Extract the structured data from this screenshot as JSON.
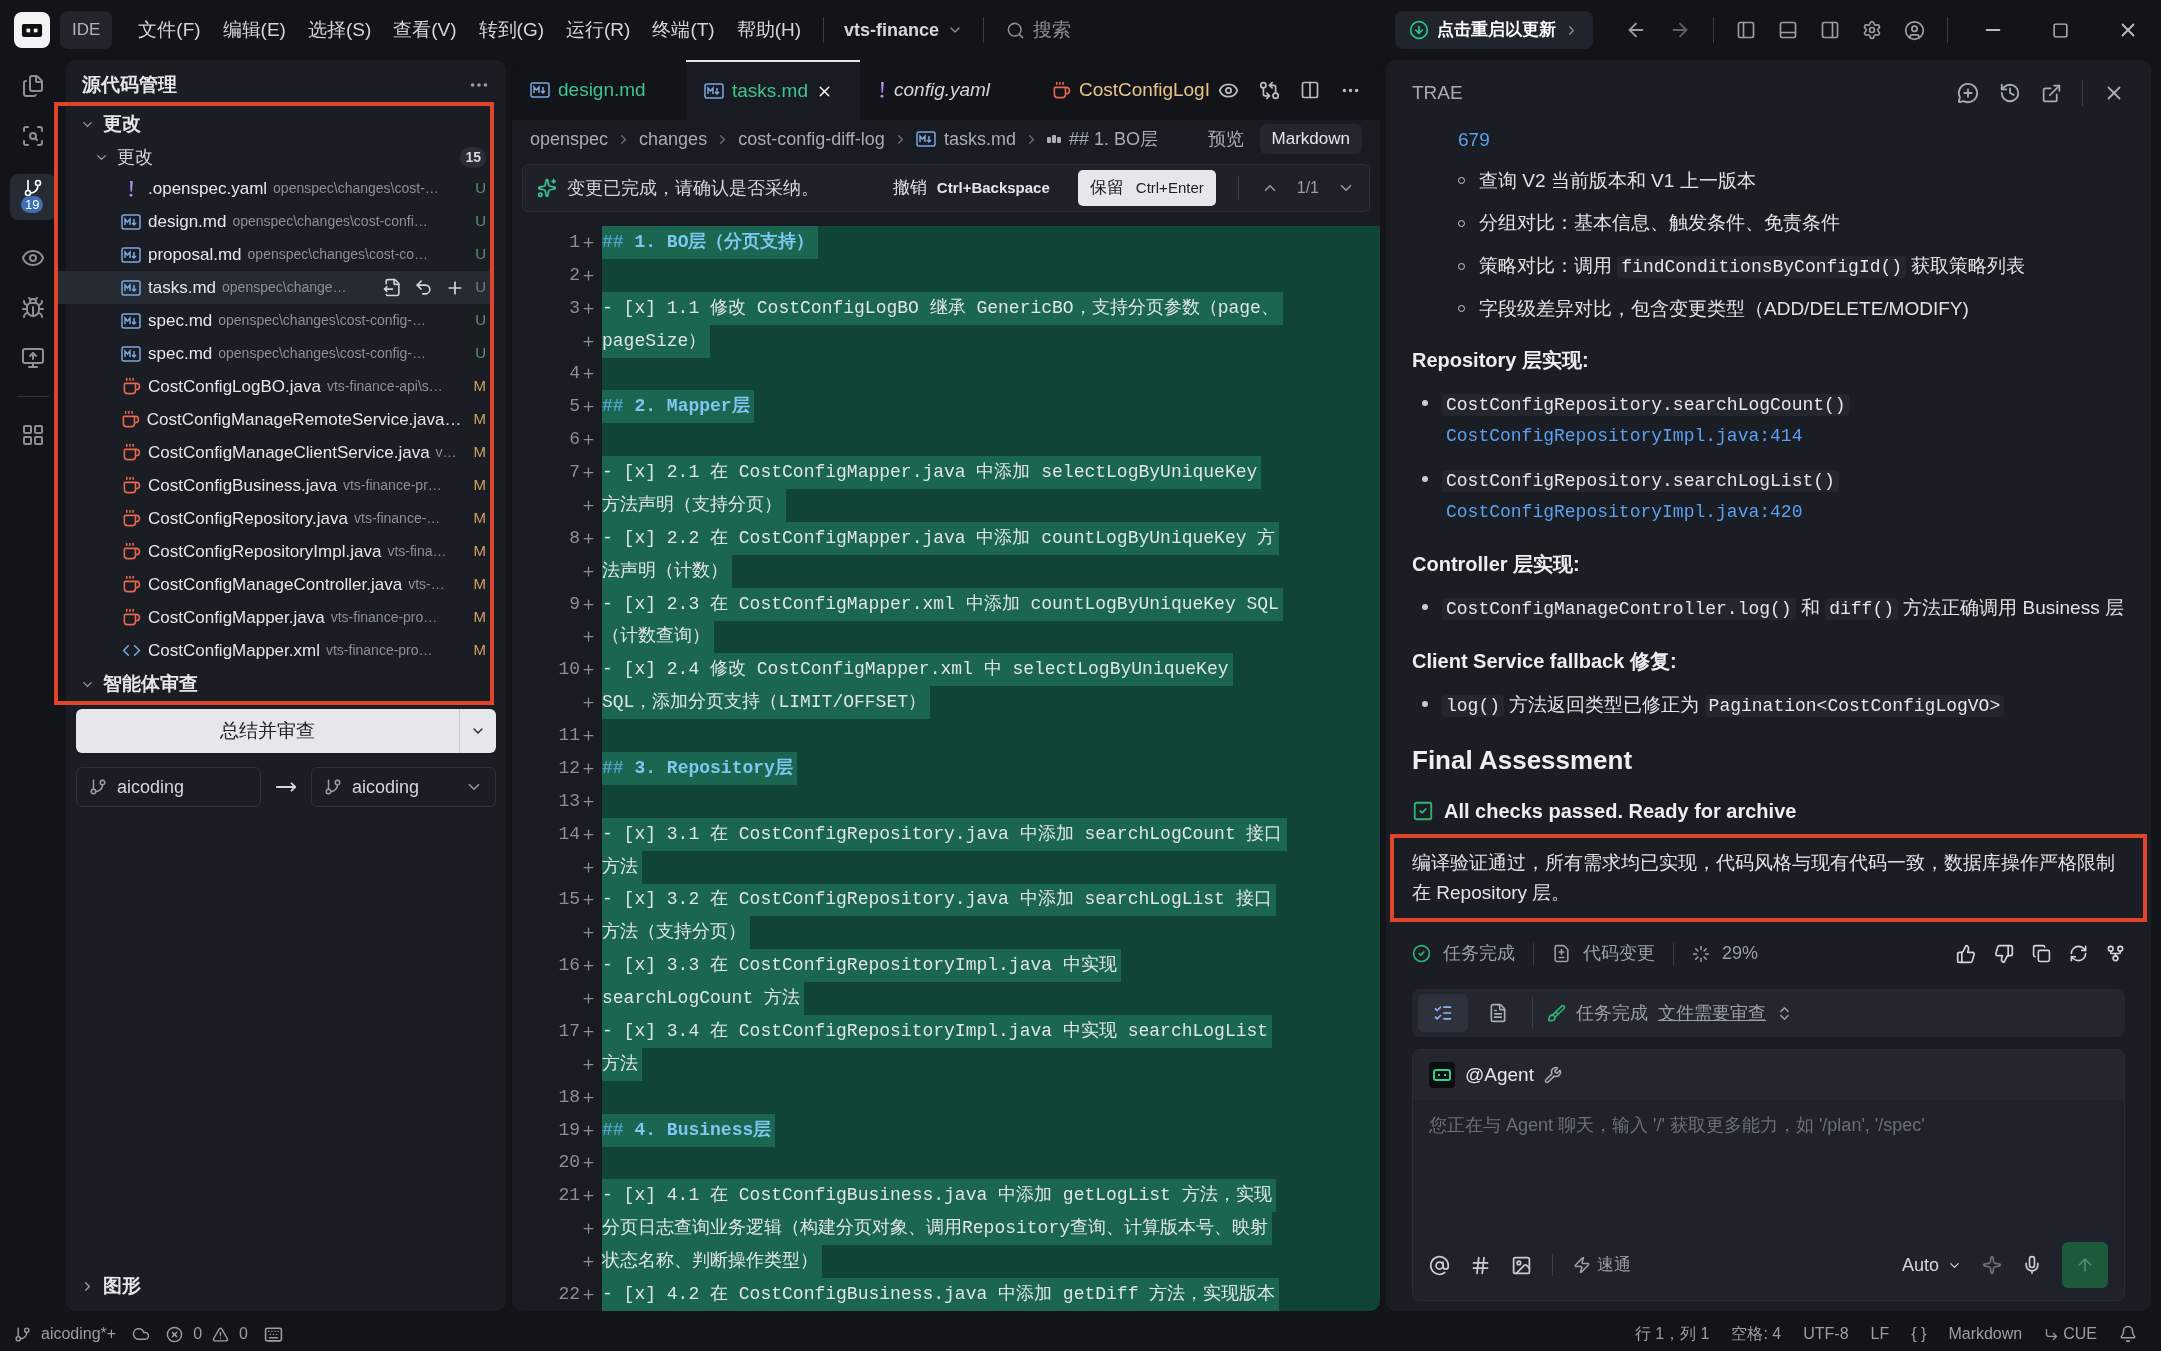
{
  "title_bar": {
    "app_label": "IDE",
    "menu": [
      "文件(F)",
      "编辑(E)",
      "选择(S)",
      "查看(V)",
      "转到(G)",
      "运行(R)",
      "终端(T)",
      "帮助(H)"
    ],
    "project": "vts-finance",
    "search_placeholder": "搜索",
    "update_button": "点击重启以更新"
  },
  "activity_bar": {
    "scm_badge": "19"
  },
  "scm_panel": {
    "title": "源代码管理",
    "section": {
      "label": "更改",
      "expanded": true
    },
    "group": {
      "label": "更改",
      "expanded": true,
      "count": "15"
    },
    "files": [
      {
        "kind": "yaml",
        "name": ".openspec.yaml",
        "path": "openspec\\changes\\cost-…",
        "status": "U",
        "selected": false
      },
      {
        "kind": "md",
        "name": "design.md",
        "path": "openspec\\changes\\cost-confi…",
        "status": "U",
        "selected": false
      },
      {
        "kind": "md",
        "name": "proposal.md",
        "path": "openspec\\changes\\cost-co…",
        "status": "U",
        "selected": false
      },
      {
        "kind": "md",
        "name": "tasks.md",
        "path": "openspec\\change…",
        "status": "U",
        "selected": true
      },
      {
        "kind": "md",
        "name": "spec.md",
        "path": "openspec\\changes\\cost-config-…",
        "status": "U",
        "selected": false
      },
      {
        "kind": "md",
        "name": "spec.md",
        "path": "openspec\\changes\\cost-config-…",
        "status": "U",
        "selected": false
      },
      {
        "kind": "java",
        "name": "CostConfigLogBO.java",
        "path": "vts-finance-api\\s…",
        "status": "M",
        "selected": false
      },
      {
        "kind": "java",
        "name": "CostConfigManageRemoteService.java…",
        "status": "M",
        "selected": false
      },
      {
        "kind": "java",
        "name": "CostConfigManageClientService.java",
        "path": "v…",
        "status": "M",
        "selected": false
      },
      {
        "kind": "java",
        "name": "CostConfigBusiness.java",
        "path": "vts-finance-pr…",
        "status": "M",
        "selected": false
      },
      {
        "kind": "java",
        "name": "CostConfigRepository.java",
        "path": "vts-finance-…",
        "status": "M",
        "selected": false
      },
      {
        "kind": "java",
        "name": "CostConfigRepositoryImpl.java",
        "path": "vts-fina…",
        "status": "M",
        "selected": false
      },
      {
        "kind": "java",
        "name": "CostConfigManageController.java",
        "path": "vts-…",
        "status": "M",
        "selected": false
      },
      {
        "kind": "java",
        "name": "CostConfigMapper.java",
        "path": "vts-finance-pro…",
        "status": "M",
        "selected": false
      },
      {
        "kind": "xml",
        "name": "CostConfigMapper.xml",
        "path": "vts-finance-pro…",
        "status": "M",
        "selected": false
      }
    ],
    "agent_section": {
      "label": "智能体审查",
      "expanded": true
    },
    "review_button": "总结并审查",
    "branch_from": "aicoding",
    "branch_to": "aicoding",
    "graph_section": {
      "label": "图形",
      "expanded": false
    }
  },
  "editor": {
    "tabs": [
      {
        "kind": "md",
        "label": "design.md",
        "selected": false
      },
      {
        "kind": "md",
        "label": "tasks.md",
        "selected": true
      },
      {
        "kind": "yaml",
        "label": "config.yaml",
        "selected": false
      },
      {
        "kind": "java",
        "label": "CostConfigLogI",
        "selected": false
      }
    ],
    "breadcrumb": [
      "openspec",
      "changes",
      "cost-config-diff-log",
      "tasks.md",
      "## 1. BO层"
    ],
    "preview": "预览",
    "language": "Markdown",
    "diff_bar": {
      "message": "变更已完成，请确认是否采纳。",
      "undo": "撤销",
      "undo_shortcut": "Ctrl+Backspace",
      "keep": "保留",
      "keep_shortcut": "Ctrl+Enter",
      "counter": "1/1"
    },
    "lines": [
      {
        "number": "1",
        "kind": "heading",
        "hash": "##",
        "text": "1. BO层（分页支持）",
        "added": true
      },
      {
        "number": "2",
        "kind": "blank",
        "added": true
      },
      {
        "number": "3",
        "kind": "item",
        "text": "- [x] 1.1 修改 CostConfigLogBO 继承 GenericBO，支持分页参数（page、",
        "added": true
      },
      {
        "kind": "wrap",
        "text": "pageSize）",
        "added": true
      },
      {
        "number": "4",
        "kind": "blank",
        "added": true
      },
      {
        "number": "5",
        "kind": "heading",
        "hash": "##",
        "text": "2. Mapper层",
        "added": true
      },
      {
        "number": "6",
        "kind": "blank",
        "added": true
      },
      {
        "number": "7",
        "kind": "item",
        "text": "- [x] 2.1 在 CostConfigMapper.java 中添加 selectLogByUniqueKey",
        "added": true
      },
      {
        "kind": "wrap",
        "text": "方法声明（支持分页）",
        "added": true
      },
      {
        "number": "8",
        "kind": "item",
        "text": "- [x] 2.2 在 CostConfigMapper.java 中添加 countLogByUniqueKey 方",
        "added": true
      },
      {
        "kind": "wrap",
        "text": "法声明（计数）",
        "added": true
      },
      {
        "number": "9",
        "kind": "item",
        "text": "- [x] 2.3 在 CostConfigMapper.xml 中添加 countLogByUniqueKey SQL",
        "added": true
      },
      {
        "kind": "wrap",
        "text": "（计数查询）",
        "added": true
      },
      {
        "number": "10",
        "kind": "item",
        "text": "- [x] 2.4 修改 CostConfigMapper.xml 中 selectLogByUniqueKey",
        "added": true
      },
      {
        "kind": "wrap",
        "text": "SQL，添加分页支持（LIMIT/OFFSET）",
        "added": true
      },
      {
        "number": "11",
        "kind": "blank",
        "added": true
      },
      {
        "number": "12",
        "kind": "heading",
        "hash": "##",
        "text": "3. Repository层",
        "added": true
      },
      {
        "number": "13",
        "kind": "blank",
        "added": true
      },
      {
        "number": "14",
        "kind": "item",
        "text": "- [x] 3.1 在 CostConfigRepository.java 中添加 searchLogCount 接口",
        "added": true
      },
      {
        "kind": "wrap",
        "text": "方法",
        "added": true
      },
      {
        "number": "15",
        "kind": "item",
        "text": "- [x] 3.2 在 CostConfigRepository.java 中添加 searchLogList 接口",
        "added": true
      },
      {
        "kind": "wrap",
        "text": "方法（支持分页）",
        "added": true
      },
      {
        "number": "16",
        "kind": "item",
        "text": "- [x] 3.3 在 CostConfigRepositoryImpl.java 中实现",
        "added": true
      },
      {
        "kind": "wrap",
        "text": "searchLogCount 方法",
        "added": true
      },
      {
        "number": "17",
        "kind": "item",
        "text": "- [x] 3.4 在 CostConfigRepositoryImpl.java 中实现 searchLogList",
        "added": true
      },
      {
        "kind": "wrap",
        "text": "方法",
        "added": true
      },
      {
        "number": "18",
        "kind": "blank",
        "added": true
      },
      {
        "number": "19",
        "kind": "heading",
        "hash": "##",
        "text": "4. Business层",
        "added": true
      },
      {
        "number": "20",
        "kind": "blank",
        "added": true
      },
      {
        "number": "21",
        "kind": "item",
        "text": "- [x] 4.1 在 CostConfigBusiness.java 中添加 getLogList 方法，实现",
        "added": true
      },
      {
        "kind": "wrap",
        "text": "分页日志查询业务逻辑（构建分页对象、调用Repository查询、计算版本号、映射",
        "added": true
      },
      {
        "kind": "wrap",
        "text": "状态名称、判断操作类型）",
        "added": true
      },
      {
        "number": "22",
        "kind": "item",
        "text": "- [x] 4.2 在 CostConfigBusiness.java 中添加 getDiff 方法，实现版本",
        "added": true
      }
    ]
  },
  "chat": {
    "title": "TRAE",
    "blocks": [
      {
        "kind": "link_line",
        "text": "679"
      },
      {
        "kind": "sub_bullets",
        "items": [
          [
            {
              "kind": "text",
              "text": "查询 V2 当前版本和 V1 上一版本"
            }
          ],
          [
            {
              "kind": "text",
              "text": "分组对比：基本信息、触发条件、免责条件"
            }
          ],
          [
            {
              "kind": "text",
              "text": "策略对比：调用 "
            },
            {
              "kind": "code",
              "text": "findConditionsByConfigId()"
            },
            {
              "kind": "text",
              "text": " 获取策略列表"
            }
          ],
          [
            {
              "kind": "text",
              "text": "字段级差异对比，包含变更类型（ADD/DELETE/MODIFY)"
            }
          ]
        ]
      },
      {
        "kind": "heading",
        "text": "Repository 层实现:"
      },
      {
        "kind": "bullets",
        "items": [
          [
            {
              "kind": "code",
              "text": "CostConfigRepository.searchLogCount()"
            },
            {
              "kind": "link",
              "text": "CostConfigRepositoryImpl.java:414"
            }
          ],
          [
            {
              "kind": "code",
              "text": "CostConfigRepository.searchLogList()"
            },
            {
              "kind": "link",
              "text": "CostConfigRepositoryImpl.java:420"
            }
          ]
        ]
      },
      {
        "kind": "heading",
        "text": "Controller 层实现:"
      },
      {
        "kind": "bullets",
        "items": [
          [
            {
              "kind": "code",
              "text": "CostConfigManageController.log()"
            },
            {
              "kind": "text",
              "text": " 和 "
            },
            {
              "kind": "code",
              "text": "diff()"
            },
            {
              "kind": "text",
              "text": " 方法正确调用 Business 层"
            }
          ]
        ]
      },
      {
        "kind": "heading",
        "text": "Client Service fallback 修复:"
      },
      {
        "kind": "bullets",
        "items": [
          [
            {
              "kind": "code",
              "text": "log()"
            },
            {
              "kind": "text",
              "text": " 方法返回类型已修正为 "
            },
            {
              "kind": "code",
              "text": "Pagination<CostConfigLogVO>"
            }
          ]
        ]
      },
      {
        "kind": "title",
        "text": "Final Assessment"
      },
      {
        "kind": "check",
        "text": "All checks passed. Ready for archive",
        "checked": true
      },
      {
        "kind": "paragraph",
        "text": "编译验证通过，所有需求均已实现，代码风格与现有代码一致，数据库操作严格限制在 Repository 层。"
      }
    ],
    "status": {
      "task": "任务完成",
      "changes": "代码变更",
      "progress": "29%"
    },
    "task_bar": {
      "label": "任务完成",
      "link": "文件需要审查"
    },
    "input": {
      "agent": "@Agent",
      "placeholder": "您正在与 Agent 聊天，输入 '/' 获取更多能力，如 '/plan', '/spec'",
      "mode": "速通",
      "model": "Auto"
    }
  },
  "status_bar": {
    "branch": "aicoding*+",
    "errors": "0",
    "warnings": "0",
    "position": "行 1，列 1",
    "spaces": "空格: 4",
    "encoding": "UTF-8",
    "eol": "LF",
    "braces": "{ }",
    "language": "Markdown",
    "cue": "CUE"
  }
}
